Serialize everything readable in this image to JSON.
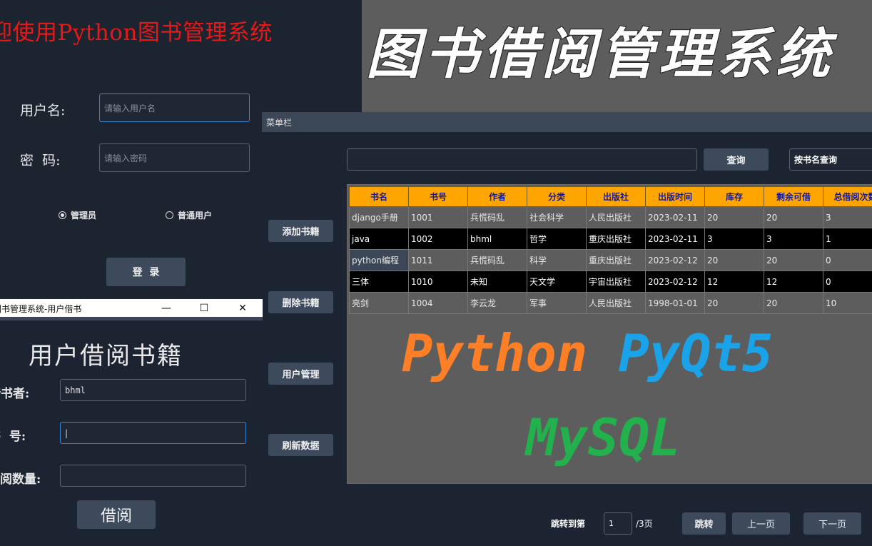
{
  "login": {
    "title": "迎使用Python图书管理系统",
    "username_label": "用户名:",
    "username_placeholder": "请输入用户名",
    "password_label": "密  码:",
    "password_placeholder": "请输入密码",
    "role_admin": "管理员",
    "role_user": "普通用户",
    "login_button": "登  录"
  },
  "banner": {
    "text": "图书借阅管理系统"
  },
  "main": {
    "menubar": "菜单栏",
    "query_button": "查询",
    "search_mode": "按书名查询",
    "side_buttons": [
      "添加书籍",
      "删除书籍",
      "用户管理",
      "刷新数据"
    ],
    "table": {
      "headers": [
        "书名",
        "书号",
        "作者",
        "分类",
        "出版社",
        "出版时间",
        "库存",
        "剩余可借",
        "总借阅次数"
      ],
      "rows": [
        [
          "django手册",
          "1001",
          "兵慌码乱",
          "社会科学",
          "人民出版社",
          "2023-02-11",
          "20",
          "20",
          "3"
        ],
        [
          "java",
          "1002",
          "bhml",
          "哲学",
          "重庆出版社",
          "2023-02-11",
          "3",
          "3",
          "1"
        ],
        [
          "python编程",
          "1011",
          "兵慌码乱",
          "科学",
          "重庆出版社",
          "2023-02-12",
          "20",
          "20",
          "0"
        ],
        [
          "三体",
          "1010",
          "未知",
          "天文学",
          "宇宙出版社",
          "2023-02-12",
          "12",
          "12",
          "0"
        ],
        [
          "亮剑",
          "1004",
          "李云龙",
          "军事",
          "人民出版社",
          "1998-01-01",
          "20",
          "20",
          "10"
        ]
      ]
    },
    "promo_python": "Python",
    "promo_pyqt": "PyQt5",
    "promo_mysql": "MySQL",
    "pager": {
      "jump_to_label": "跳转到第",
      "page_value": "1",
      "total_label": "/3页",
      "jump_button": "跳转",
      "prev_button": "上一页",
      "next_button": "下一页"
    }
  },
  "borrow": {
    "window_title": "图书管理系统-用户借书",
    "heading": "用户借阅书籍",
    "reader_label": "借书者:",
    "reader_value": "bhml",
    "booknum_label": "书  号:",
    "booknum_value": "|",
    "count_label": "借阅数量:",
    "borrow_button": "借阅"
  },
  "colors": {
    "title_red": "#e81818",
    "header_orange": "#ffa500",
    "header_text": "#1a1a8c",
    "python_orange": "#ff7f27",
    "pyqt_blue": "#1aa3e8",
    "mysql_green": "#22b14c",
    "button": "#3d4a5c"
  }
}
